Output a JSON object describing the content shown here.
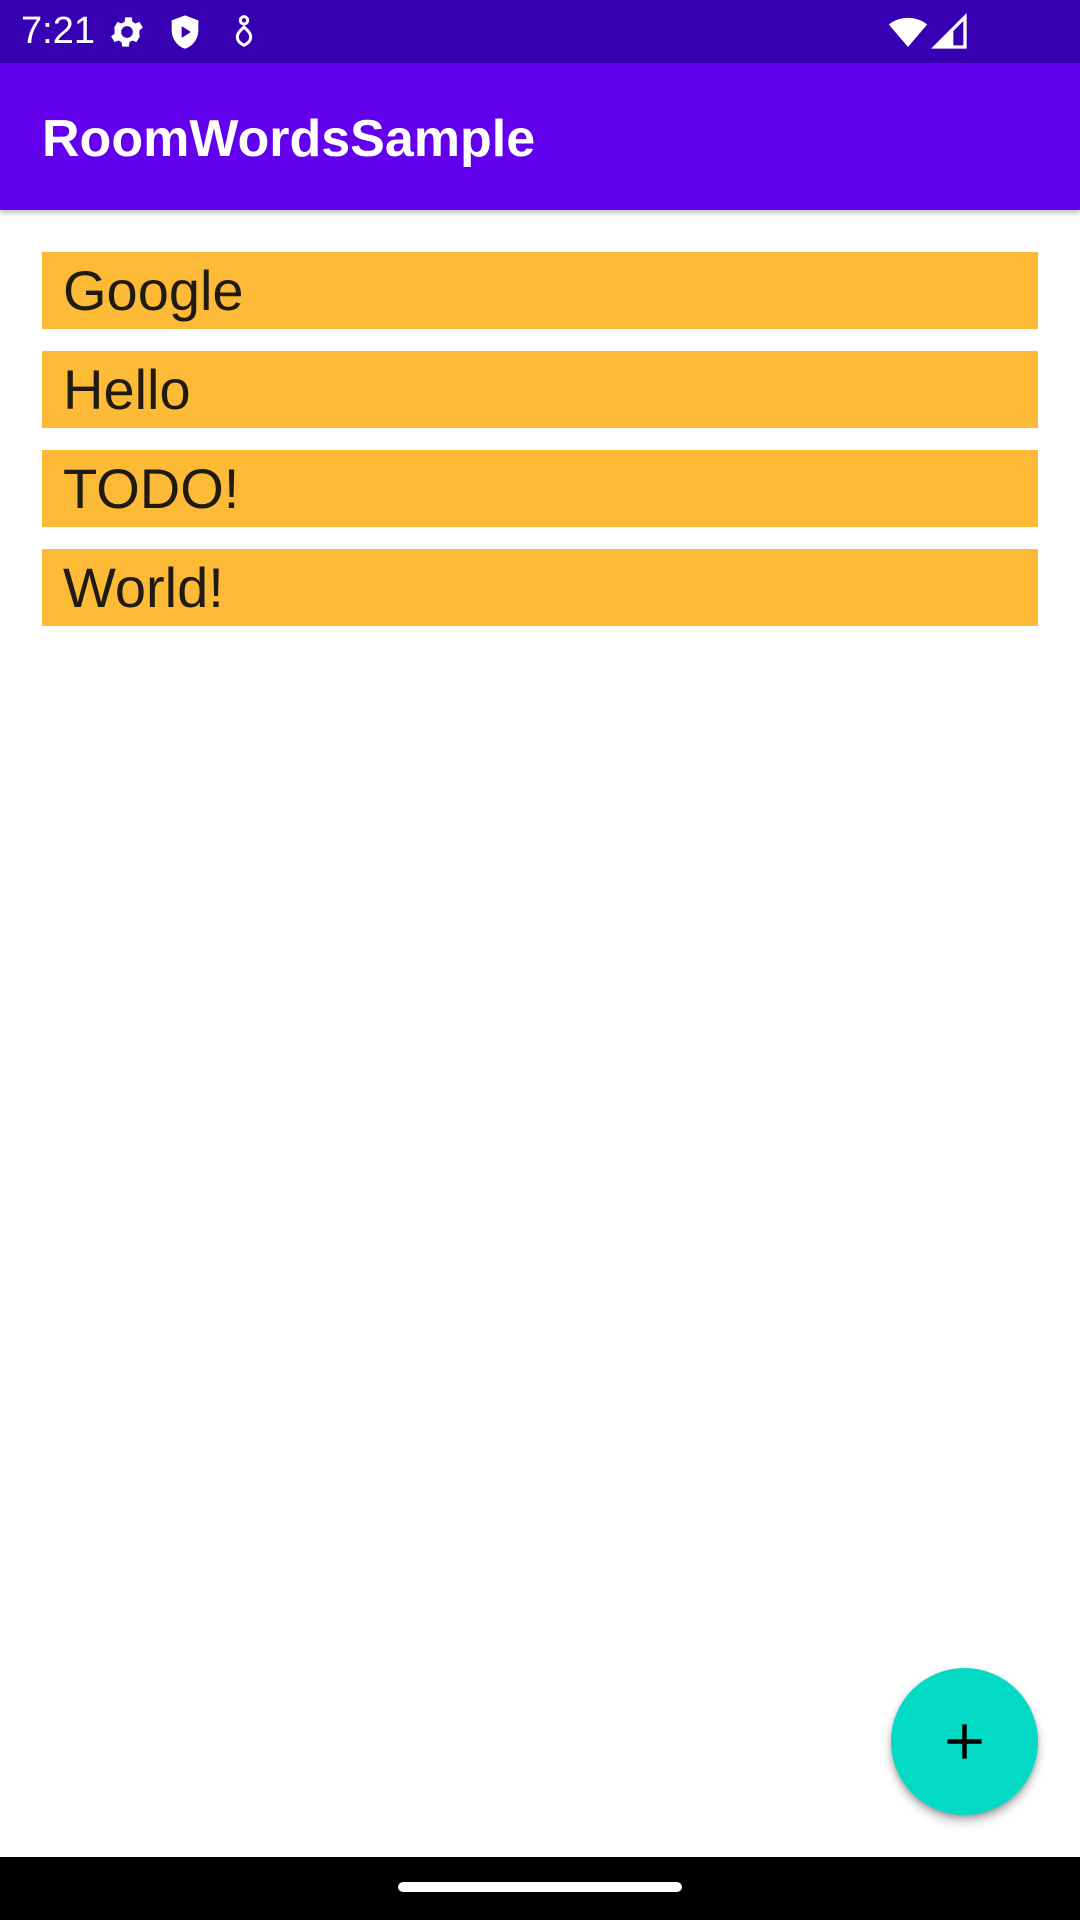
{
  "status_bar": {
    "time": "7:21",
    "background": "#3700b3",
    "icons_left": [
      "settings-icon",
      "shield-play-icon",
      "accessibility-icon"
    ],
    "icons_right": [
      "wifi-icon",
      "cellular-signal-icon"
    ]
  },
  "app_bar": {
    "title": "RoomWordsSample",
    "background": "#6200ee"
  },
  "words": [
    "Google",
    "Hello",
    "TODO!",
    "World!"
  ],
  "word_item_color": "#fdba36",
  "fab": {
    "icon": "add-icon",
    "color": "#03dac5"
  },
  "nav_bar": {
    "handle": "home-indicator"
  }
}
